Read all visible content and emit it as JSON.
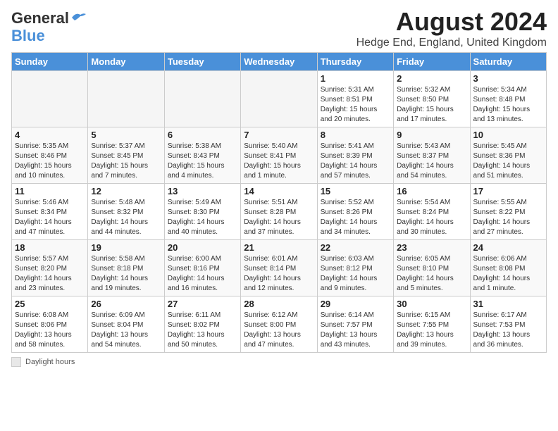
{
  "header": {
    "logo_line1": "General",
    "logo_line2": "Blue",
    "main_title": "August 2024",
    "subtitle": "Hedge End, England, United Kingdom"
  },
  "calendar": {
    "days_of_week": [
      "Sunday",
      "Monday",
      "Tuesday",
      "Wednesday",
      "Thursday",
      "Friday",
      "Saturday"
    ],
    "weeks": [
      [
        {
          "day": "",
          "info": ""
        },
        {
          "day": "",
          "info": ""
        },
        {
          "day": "",
          "info": ""
        },
        {
          "day": "",
          "info": ""
        },
        {
          "day": "1",
          "info": "Sunrise: 5:31 AM\nSunset: 8:51 PM\nDaylight: 15 hours\nand 20 minutes."
        },
        {
          "day": "2",
          "info": "Sunrise: 5:32 AM\nSunset: 8:50 PM\nDaylight: 15 hours\nand 17 minutes."
        },
        {
          "day": "3",
          "info": "Sunrise: 5:34 AM\nSunset: 8:48 PM\nDaylight: 15 hours\nand 13 minutes."
        }
      ],
      [
        {
          "day": "4",
          "info": "Sunrise: 5:35 AM\nSunset: 8:46 PM\nDaylight: 15 hours\nand 10 minutes."
        },
        {
          "day": "5",
          "info": "Sunrise: 5:37 AM\nSunset: 8:45 PM\nDaylight: 15 hours\nand 7 minutes."
        },
        {
          "day": "6",
          "info": "Sunrise: 5:38 AM\nSunset: 8:43 PM\nDaylight: 15 hours\nand 4 minutes."
        },
        {
          "day": "7",
          "info": "Sunrise: 5:40 AM\nSunset: 8:41 PM\nDaylight: 15 hours\nand 1 minute."
        },
        {
          "day": "8",
          "info": "Sunrise: 5:41 AM\nSunset: 8:39 PM\nDaylight: 14 hours\nand 57 minutes."
        },
        {
          "day": "9",
          "info": "Sunrise: 5:43 AM\nSunset: 8:37 PM\nDaylight: 14 hours\nand 54 minutes."
        },
        {
          "day": "10",
          "info": "Sunrise: 5:45 AM\nSunset: 8:36 PM\nDaylight: 14 hours\nand 51 minutes."
        }
      ],
      [
        {
          "day": "11",
          "info": "Sunrise: 5:46 AM\nSunset: 8:34 PM\nDaylight: 14 hours\nand 47 minutes."
        },
        {
          "day": "12",
          "info": "Sunrise: 5:48 AM\nSunset: 8:32 PM\nDaylight: 14 hours\nand 44 minutes."
        },
        {
          "day": "13",
          "info": "Sunrise: 5:49 AM\nSunset: 8:30 PM\nDaylight: 14 hours\nand 40 minutes."
        },
        {
          "day": "14",
          "info": "Sunrise: 5:51 AM\nSunset: 8:28 PM\nDaylight: 14 hours\nand 37 minutes."
        },
        {
          "day": "15",
          "info": "Sunrise: 5:52 AM\nSunset: 8:26 PM\nDaylight: 14 hours\nand 34 minutes."
        },
        {
          "day": "16",
          "info": "Sunrise: 5:54 AM\nSunset: 8:24 PM\nDaylight: 14 hours\nand 30 minutes."
        },
        {
          "day": "17",
          "info": "Sunrise: 5:55 AM\nSunset: 8:22 PM\nDaylight: 14 hours\nand 27 minutes."
        }
      ],
      [
        {
          "day": "18",
          "info": "Sunrise: 5:57 AM\nSunset: 8:20 PM\nDaylight: 14 hours\nand 23 minutes."
        },
        {
          "day": "19",
          "info": "Sunrise: 5:58 AM\nSunset: 8:18 PM\nDaylight: 14 hours\nand 19 minutes."
        },
        {
          "day": "20",
          "info": "Sunrise: 6:00 AM\nSunset: 8:16 PM\nDaylight: 14 hours\nand 16 minutes."
        },
        {
          "day": "21",
          "info": "Sunrise: 6:01 AM\nSunset: 8:14 PM\nDaylight: 14 hours\nand 12 minutes."
        },
        {
          "day": "22",
          "info": "Sunrise: 6:03 AM\nSunset: 8:12 PM\nDaylight: 14 hours\nand 9 minutes."
        },
        {
          "day": "23",
          "info": "Sunrise: 6:05 AM\nSunset: 8:10 PM\nDaylight: 14 hours\nand 5 minutes."
        },
        {
          "day": "24",
          "info": "Sunrise: 6:06 AM\nSunset: 8:08 PM\nDaylight: 14 hours\nand 1 minute."
        }
      ],
      [
        {
          "day": "25",
          "info": "Sunrise: 6:08 AM\nSunset: 8:06 PM\nDaylight: 13 hours\nand 58 minutes."
        },
        {
          "day": "26",
          "info": "Sunrise: 6:09 AM\nSunset: 8:04 PM\nDaylight: 13 hours\nand 54 minutes."
        },
        {
          "day": "27",
          "info": "Sunrise: 6:11 AM\nSunset: 8:02 PM\nDaylight: 13 hours\nand 50 minutes."
        },
        {
          "day": "28",
          "info": "Sunrise: 6:12 AM\nSunset: 8:00 PM\nDaylight: 13 hours\nand 47 minutes."
        },
        {
          "day": "29",
          "info": "Sunrise: 6:14 AM\nSunset: 7:57 PM\nDaylight: 13 hours\nand 43 minutes."
        },
        {
          "day": "30",
          "info": "Sunrise: 6:15 AM\nSunset: 7:55 PM\nDaylight: 13 hours\nand 39 minutes."
        },
        {
          "day": "31",
          "info": "Sunrise: 6:17 AM\nSunset: 7:53 PM\nDaylight: 13 hours\nand 36 minutes."
        }
      ]
    ]
  },
  "footer": {
    "label": "Daylight hours"
  }
}
